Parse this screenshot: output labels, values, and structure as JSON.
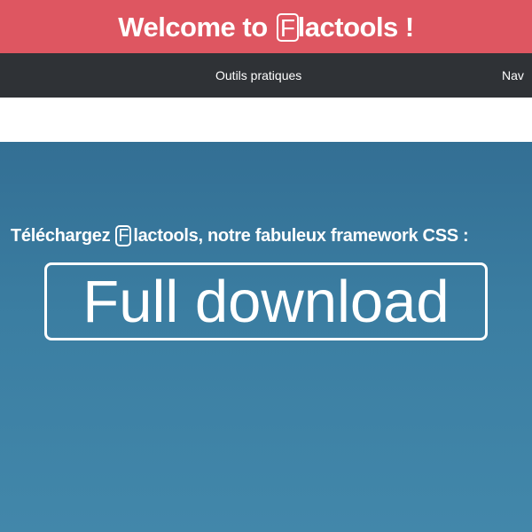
{
  "banner": {
    "prefix": "Welcome to",
    "logo_letter": "F",
    "suffix": "lactools !"
  },
  "nav": {
    "items": [
      {
        "label": "Outils pratiques"
      },
      {
        "label": "Nav"
      }
    ]
  },
  "hero": {
    "intro_prefix": "Téléchargez",
    "logo_letter": "F",
    "intro_suffix": "lactools, notre fabuleux framework CSS :",
    "download_label": "Full download"
  }
}
